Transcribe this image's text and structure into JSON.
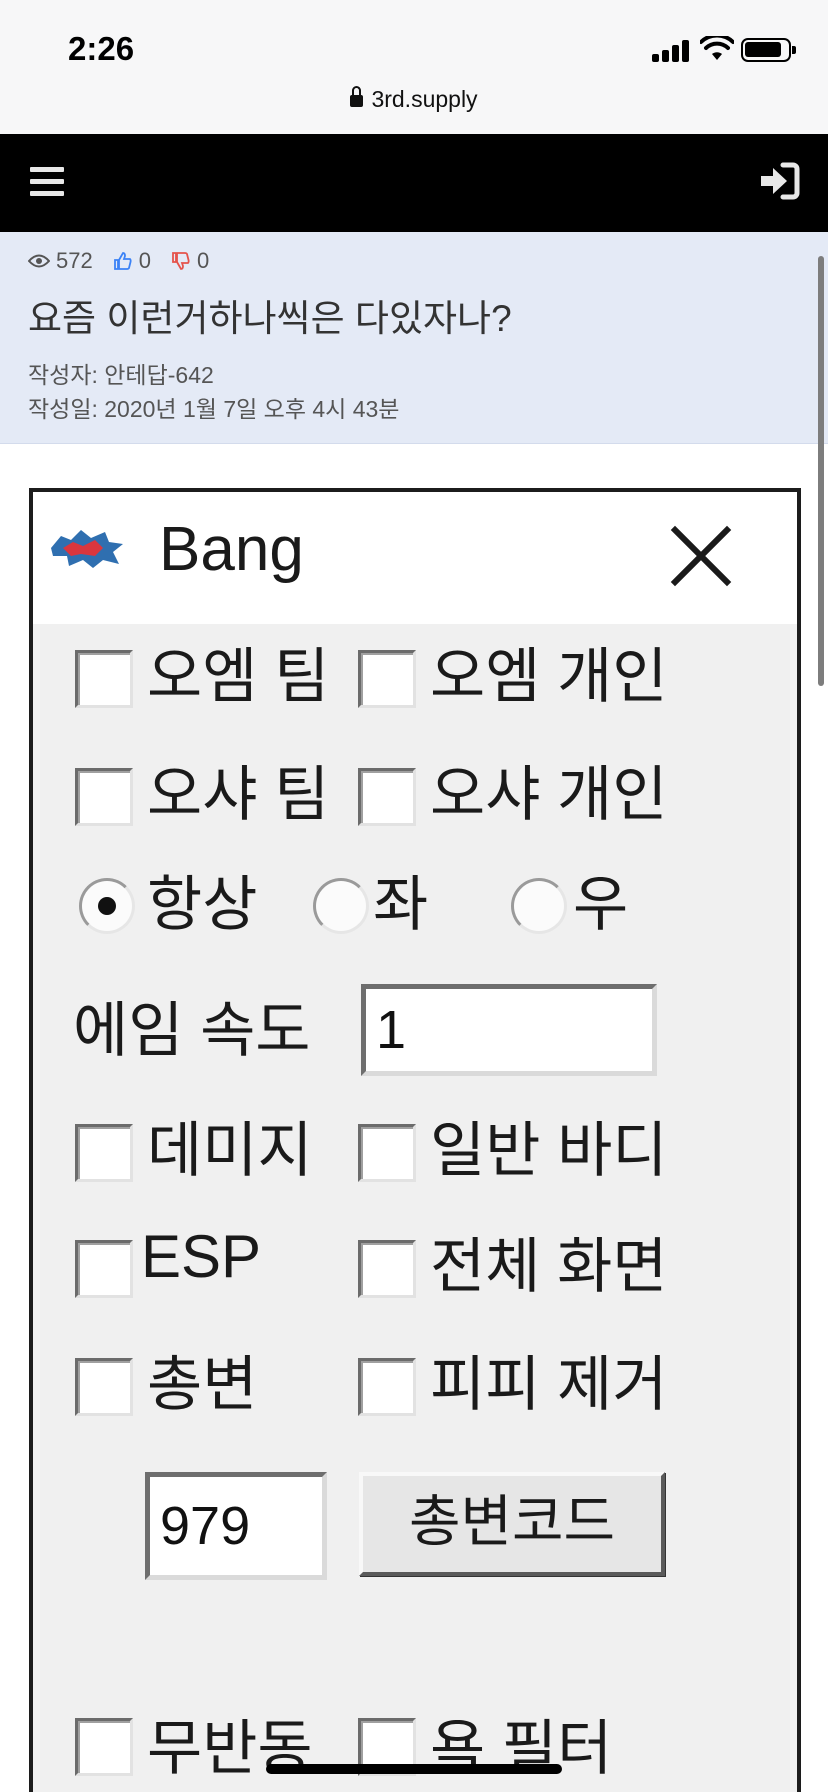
{
  "status_bar": {
    "time": "2:26"
  },
  "browser": {
    "url": "3rd.supply"
  },
  "site_nav": {
    "menu_icon": "hamburger-icon",
    "login_icon": "sign-in-icon"
  },
  "post": {
    "views": "572",
    "likes": "0",
    "dislikes": "0",
    "title": "요즘 이런거하나씩은 다있자나?",
    "author": "작성자: 안테답-642",
    "date": "작성일: 2020년 1월 7일 오후 4시 43분"
  },
  "app_window": {
    "title": "Bang",
    "options": {
      "om_team": "오엠 팀",
      "om_personal": "오엠 개인",
      "osha_team": "오샤 팀",
      "osha_personal": "오샤 개인",
      "radio_always": "항상",
      "radio_left": "좌",
      "radio_right": "우",
      "aim_speed_label": "에임 속도",
      "aim_speed_value": "1",
      "damage": "데미지",
      "normal_body": "일반 바디",
      "esp": "ESP",
      "fullscreen": "전체 화면",
      "gun_mod": "총변",
      "remove_pipi": "피피 제거",
      "gun_code_value": "979",
      "gun_code_button": "총변코드",
      "no_recoil": "무반동",
      "swear_filter": "욕 필터"
    },
    "selected_radio": "항상"
  },
  "colors": {
    "nav_bg": "#000000",
    "post_header_bg": "#e4eaf6",
    "like_icon": "#3b82f6",
    "dislike_icon": "#e5534b"
  }
}
